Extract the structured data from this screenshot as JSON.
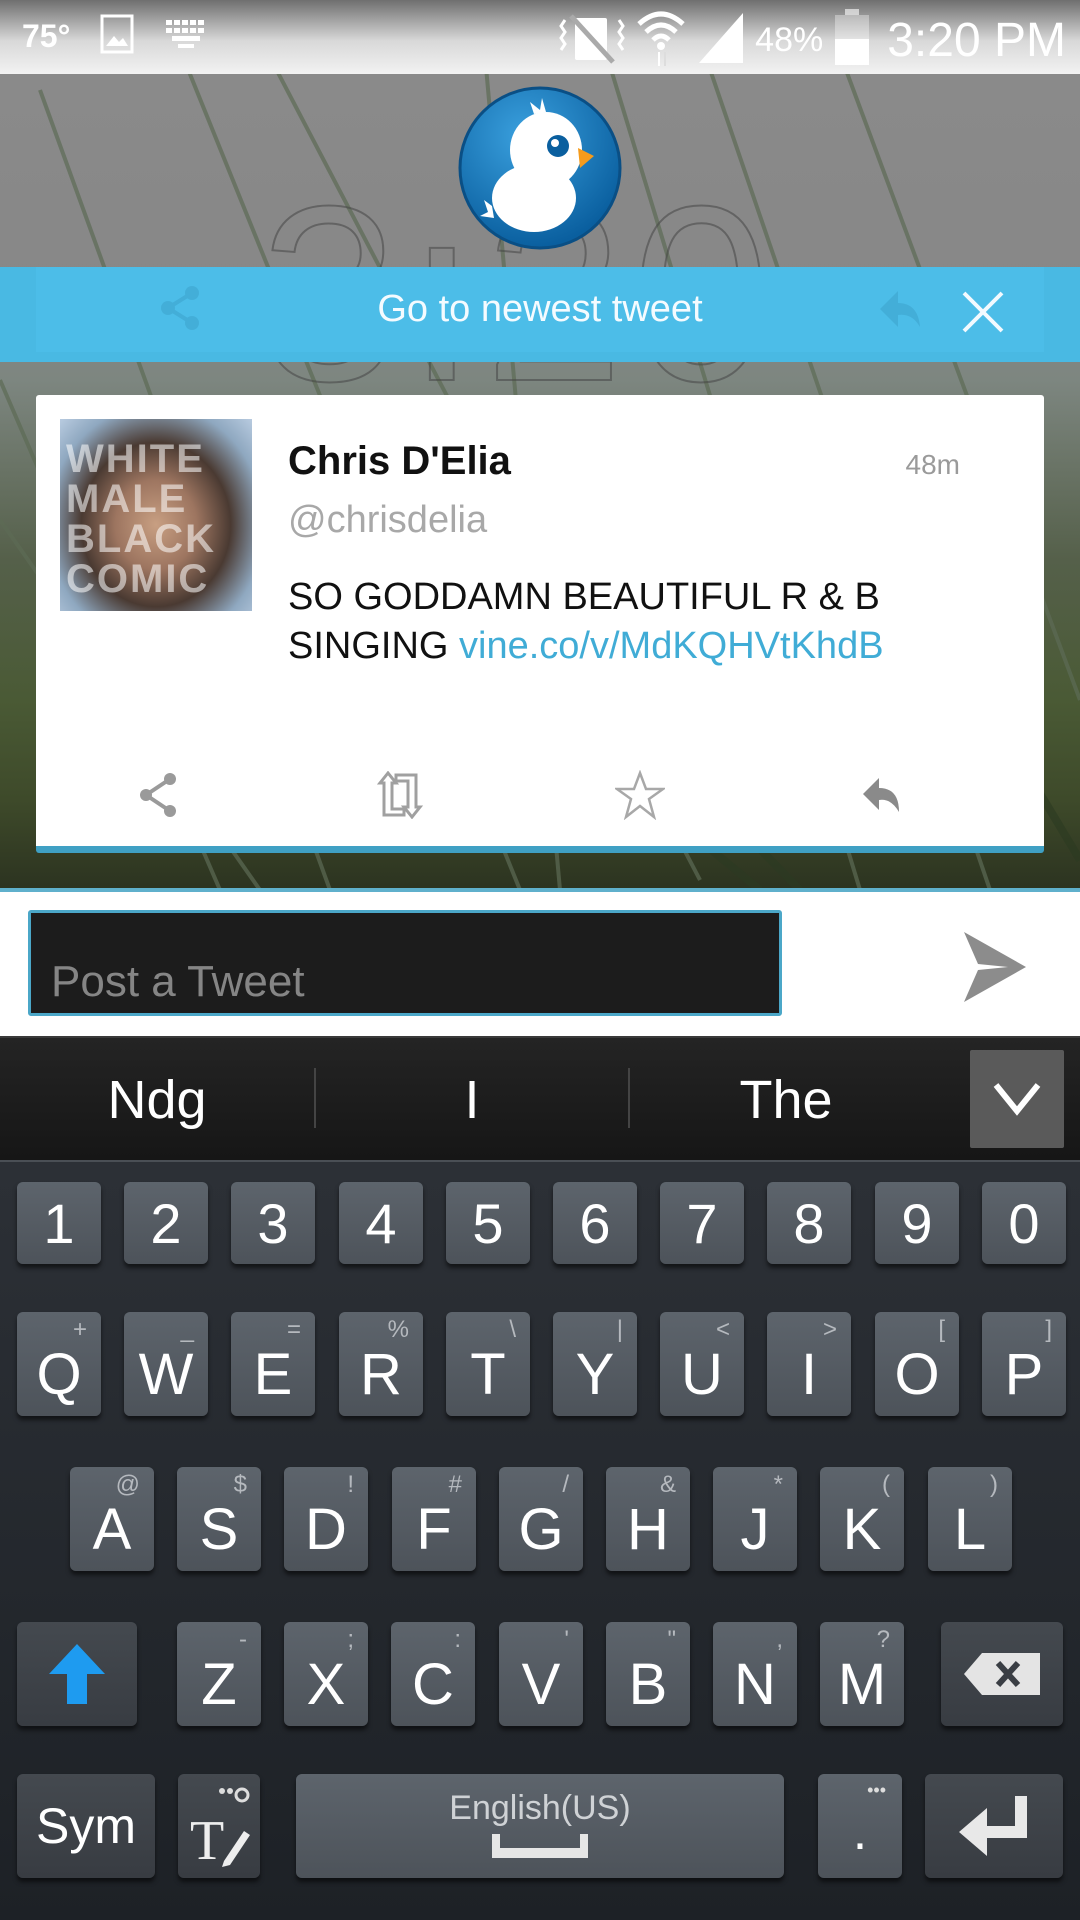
{
  "status_bar": {
    "temperature": "75°",
    "icons_left": [
      "image-notification-icon",
      "keyboard-notification-icon"
    ],
    "icons_right": [
      "vibrate-mute-icon",
      "wifi-icon",
      "signal-icon",
      "battery-icon"
    ],
    "battery_percent": "48%",
    "time": "3:20 PM"
  },
  "lockscreen": {
    "clock_ghost": "3:20"
  },
  "banner": {
    "label": "Go to newest tweet"
  },
  "tweet": {
    "author_name": "Chris D'Elia",
    "handle": "@chrisdelia",
    "age": "48m",
    "text": "SO GODDAMN BEAUTIFUL R & B SINGING ",
    "link_text": "vine.co/v/MdKQHVtKhdB",
    "avatar_overlay_text": "WHITE MALE BLACK COMIC",
    "actions": [
      "share",
      "retweet",
      "favorite",
      "reply"
    ]
  },
  "compose": {
    "placeholder": "Post a Tweet",
    "value": ""
  },
  "suggestions": [
    "Ndg",
    "I",
    "The"
  ],
  "keyboard": {
    "number_row": [
      "1",
      "2",
      "3",
      "4",
      "5",
      "6",
      "7",
      "8",
      "9",
      "0"
    ],
    "row1": [
      {
        "key": "Q",
        "alt": "+"
      },
      {
        "key": "W",
        "alt": "_"
      },
      {
        "key": "E",
        "alt": "="
      },
      {
        "key": "R",
        "alt": "%"
      },
      {
        "key": "T",
        "alt": "\\"
      },
      {
        "key": "Y",
        "alt": "|"
      },
      {
        "key": "U",
        "alt": "<"
      },
      {
        "key": "I",
        "alt": ">"
      },
      {
        "key": "O",
        "alt": "["
      },
      {
        "key": "P",
        "alt": "]"
      }
    ],
    "row2": [
      {
        "key": "A",
        "alt": "@"
      },
      {
        "key": "S",
        "alt": "$"
      },
      {
        "key": "D",
        "alt": "!"
      },
      {
        "key": "F",
        "alt": "#"
      },
      {
        "key": "G",
        "alt": "/"
      },
      {
        "key": "H",
        "alt": "&"
      },
      {
        "key": "J",
        "alt": "*"
      },
      {
        "key": "K",
        "alt": "("
      },
      {
        "key": "L",
        "alt": ")"
      }
    ],
    "row3": [
      {
        "key": "Z",
        "alt": "-"
      },
      {
        "key": "X",
        "alt": ";"
      },
      {
        "key": "C",
        "alt": ":"
      },
      {
        "key": "V",
        "alt": "'"
      },
      {
        "key": "B",
        "alt": "\""
      },
      {
        "key": "N",
        "alt": ","
      },
      {
        "key": "M",
        "alt": "?"
      }
    ],
    "sym_label": "Sym",
    "space_label": "English(US)",
    "period_label": ".",
    "period_alt": "•••",
    "accent_color": "#1e9bf0"
  },
  "colors": {
    "banner": "#4cbde8",
    "link": "#40acd6",
    "card_bottom": "#3fa0c4"
  }
}
